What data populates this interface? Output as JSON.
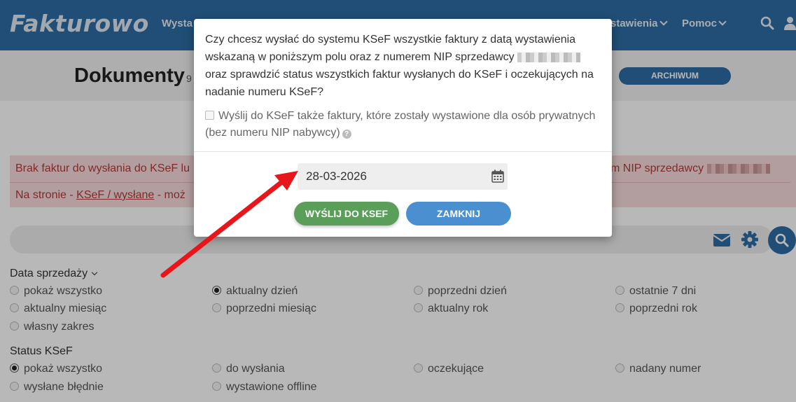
{
  "header": {
    "logo": "Fakturowo",
    "nav": [
      {
        "label": "Wysta"
      },
      {
        "label": "stawienia"
      },
      {
        "label": "Pomoc"
      }
    ]
  },
  "page": {
    "title": "Dokumenty",
    "count": "9",
    "archive_button": "ARCHIWUM"
  },
  "alert": {
    "line1_start": "Brak faktur do wysłania do KSeF lu",
    "line1_end": "m NIP sprzedawcy",
    "line2_prefix": "Na stronie - ",
    "line2_link": "KSeF / wysłane",
    "line2_suffix": " - moż"
  },
  "filters": {
    "sale_date": {
      "label": "Data sprzedaży",
      "options": [
        "pokaż wszystko",
        "aktualny dzień",
        "poprzedni dzień",
        "ostatnie 7 dni",
        "aktualny miesiąc",
        "poprzedni miesiąc",
        "aktualny rok",
        "poprzedni rok",
        "własny zakres"
      ],
      "selected": "aktualny dzień"
    },
    "ksef_status": {
      "label": "Status KSeF",
      "options": [
        "pokaż wszystko",
        "do wysłania",
        "oczekujące",
        "nadany numer",
        "wysłane błędnie",
        "wystawione offline"
      ],
      "selected": "pokaż wszystko"
    }
  },
  "modal": {
    "question_1": "Czy chcesz wysłać do systemu KSeF wszystkie faktury z datą wystawienia wskazaną w poniższym polu oraz z numerem NIP sprzedawcy",
    "question_2": "oraz sprawdzić status wszystkich faktur wysłanych do KSeF i oczekujących na nadanie numeru KSeF?",
    "checkbox_label": "Wyślij do KSeF także faktury, które zostały wystawione dla osób prywatnych (bez numeru NIP nabywcy)",
    "date_value": "28-03-2026",
    "send_button": "WYŚLIJ DO KSEF",
    "close_button": "ZAMKNIJ"
  },
  "colors": {
    "header": "#2e6da4",
    "send": "#5a9e5a",
    "close": "#4a8fd0",
    "alert_bg": "#f7dcdc",
    "arrow": "#e8161b"
  },
  "icons": [
    "search-icon",
    "user-icon",
    "envelope-icon",
    "gear-icon",
    "calendar-icon",
    "help-icon"
  ]
}
